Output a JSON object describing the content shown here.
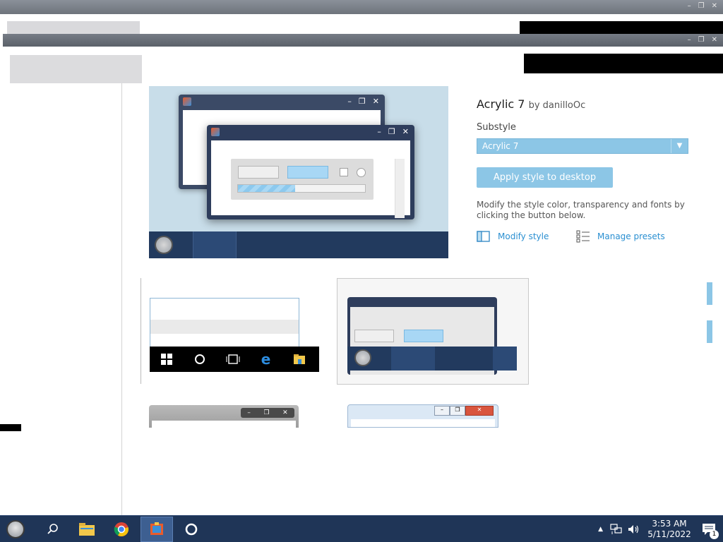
{
  "window_controls": {
    "minimize": "–",
    "restore": "❐",
    "close": "✕"
  },
  "style": {
    "name": "Acrylic 7",
    "by": "by danilloOc",
    "substyle_label": "Substyle",
    "substyle_value": "Acrylic 7",
    "apply_label": "Apply style to desktop",
    "description": "Modify the style color, transparency and fonts by clicking the button below.",
    "modify_label": "Modify style",
    "presets_label": "Manage presets"
  },
  "preview": {
    "progress_fraction": 0.45
  },
  "colors": {
    "accent": "#8cc6e6",
    "link": "#2a8fd1",
    "taskbar": "#1f3557"
  },
  "taskbar": {
    "apps": [
      {
        "name": "search-icon",
        "glyph": "⚲"
      },
      {
        "name": "file-explorer-icon",
        "glyph": "📁"
      },
      {
        "name": "chrome-icon",
        "glyph": "◉"
      },
      {
        "name": "stardock-app-icon",
        "glyph": "▦"
      },
      {
        "name": "cortana-icon",
        "glyph": "◯"
      }
    ],
    "tray": {
      "chevron": "▲",
      "network_icon": "network-icon",
      "volume_icon": "volume-icon",
      "time": "3:53 AM",
      "date": "5/11/2022",
      "notification_count": "1"
    }
  }
}
